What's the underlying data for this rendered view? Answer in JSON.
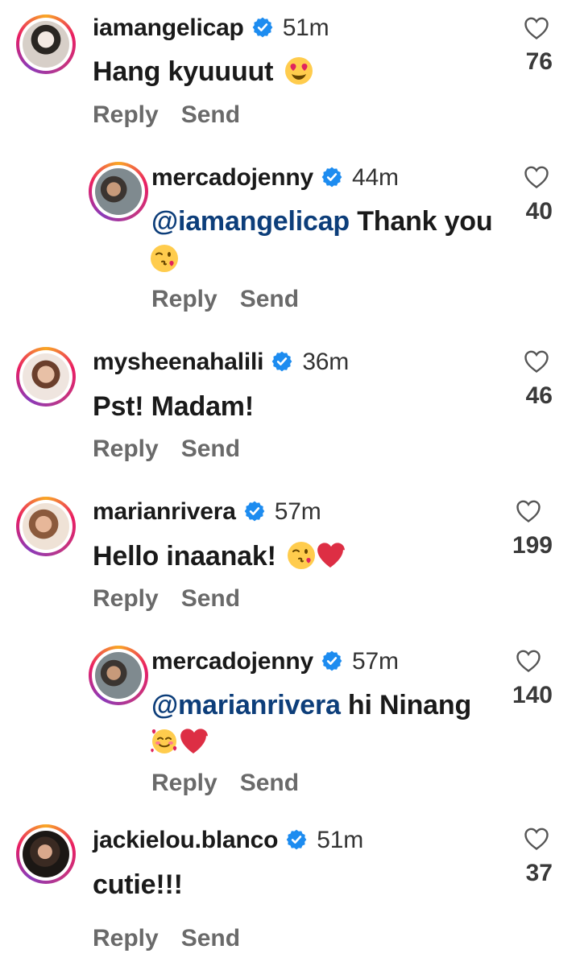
{
  "actions": {
    "reply_label": "Reply",
    "send_label": "Send"
  },
  "colors": {
    "mention": "#0d3e7a",
    "verified": "#1d8cf0",
    "secondary_text": "#6a6a6a"
  },
  "comments": [
    {
      "username": "iamangelicap",
      "verified": true,
      "time": "51m",
      "text": "Hang kyuuuut",
      "mention": "",
      "emoji": [
        "smiling-face-with-heart-eyes"
      ],
      "likes": "76"
    },
    {
      "username": "mercadojenny",
      "verified": true,
      "time": "44m",
      "mention": "@iamangelicap",
      "text": " Thank you",
      "emoji": [
        "face-blowing-a-kiss"
      ],
      "likes": "40",
      "is_reply": true
    },
    {
      "username": "mysheenahalili",
      "verified": true,
      "time": "36m",
      "text": "Pst! Madam!",
      "mention": "",
      "emoji": [],
      "likes": "46"
    },
    {
      "username": "marianrivera",
      "verified": true,
      "time": "57m",
      "text": "Hello inaanak!",
      "mention": "",
      "emoji": [
        "face-blowing-a-kiss",
        "red-heart"
      ],
      "likes": "199"
    },
    {
      "username": "mercadojenny",
      "verified": true,
      "time": "57m",
      "mention": "@marianrivera",
      "text": " hi Ninang",
      "emoji": [
        "smiling-face-with-hearts",
        "red-heart"
      ],
      "likes": "140",
      "is_reply": true
    },
    {
      "username": "jackielou.blanco",
      "verified": true,
      "time": "51m",
      "text": "cutie!!!",
      "mention": "",
      "emoji": [],
      "likes": "37"
    }
  ]
}
